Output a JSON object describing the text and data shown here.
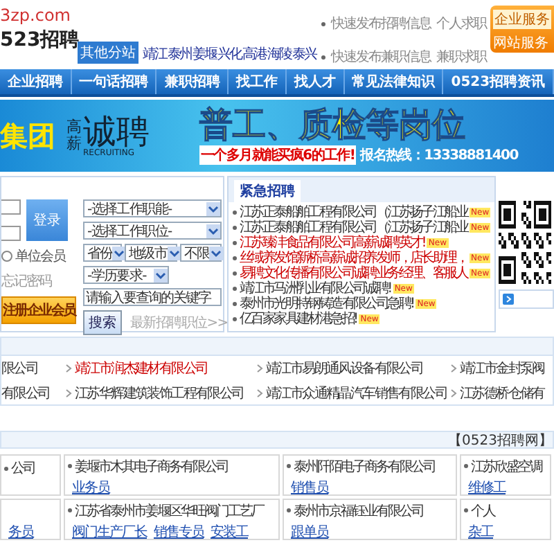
{
  "header": {
    "logo_domain": "3zp.com",
    "logo_name": "523招聘",
    "substation_button": "其他分站",
    "cities": [
      "靖江",
      "泰州",
      "姜堰",
      "兴化",
      "高港",
      "海陵",
      "泰兴"
    ],
    "quick_links": [
      {
        "text": "快速发布招聘信息",
        "extra": "个人求职"
      },
      {
        "text": "快速发布兼职信息",
        "extra": "兼职求职"
      }
    ],
    "service_box": {
      "tag": "企业服务",
      "line": "网站服务"
    }
  },
  "nav": {
    "items": [
      "企业招聘",
      "一句话招聘",
      "兼职招聘",
      "找工作",
      "找人才",
      "常见法律知识",
      "0523招聘资讯"
    ]
  },
  "banner": {
    "left_text": "集团",
    "small_text": "高薪",
    "big_text": "诚聘",
    "english": "RECRUITING",
    "headline": "普工、质检等岗位",
    "slogan": "一个多月就能买疯6的工作!",
    "hotline": "报名热线：13338881400"
  },
  "login": {
    "login_button": "登录",
    "radio_label": "单位会员",
    "radio_checked": false,
    "forgot": "忘记密码",
    "register": "注册企业会员"
  },
  "search": {
    "function": "-选择工作职能-",
    "position": "-选择工作职位-",
    "province": "省份",
    "city": "地级市",
    "limit": "不限",
    "education": "-学历要求-",
    "keyword_value": "请输入要查询的关键字",
    "search_button": "搜索",
    "latest_link": "最新招聘职位>>"
  },
  "urgent": {
    "title": "紧急招聘",
    "items": [
      {
        "text": "江苏正泰船舶工程有限公司（江苏扬子江船业",
        "color": "#333333",
        "badge": "New"
      },
      {
        "text": "江苏正泰船舶工程有限公司（江苏扬子江船业",
        "color": "#333333",
        "badge": "New"
      },
      {
        "text": "江苏臻沣食品有限公司高薪诚聘英才!",
        "color": "#cc0000",
        "badge": "New"
      },
      {
        "text": "丝域养发馆新桥高薪诚招养发师，店长助理，",
        "color": "#cc0000",
        "badge": "New"
      },
      {
        "text": "易聘文化传播有限公司诚聘业务经理、客服人",
        "color": "#cc0000",
        "badge": "New"
      },
      {
        "text": "靖江市马洲乳业有限公司诚聘!",
        "color": "#333333",
        "badge": "New"
      },
      {
        "text": "泰州市光明特钢铸造有限公司急聘!",
        "color": "#333333",
        "badge": "New"
      },
      {
        "text": "亿百家家具建材港急招!",
        "color": "#333333",
        "badge": "New"
      }
    ]
  },
  "companies": {
    "rows": [
      [
        {
          "text": "限公司",
          "color": "#333333"
        },
        {
          "text": "靖江市润杰建材有限公司",
          "color": "#cc0000"
        },
        {
          "text": "靖江市易朗通风设备有限公司",
          "color": "#333333"
        },
        {
          "text": "靖江市金封泵阀",
          "color": "#333333"
        }
      ],
      [
        {
          "text": "有限公司",
          "color": "#333333"
        },
        {
          "text": "江苏华辉建筑装饰工程有限公司",
          "color": "#333333"
        },
        {
          "text": "靖江市众通精晶汽车销售有限公司",
          "color": "#333333"
        },
        {
          "text": "江苏德桥仓储有",
          "color": "#333333"
        }
      ]
    ]
  },
  "jobs": {
    "source": "【0523招聘网】",
    "cards": [
      {
        "company": "公司"
      },
      {
        "company": "姜堰市木其电子商务有限公司",
        "jobs": [
          "业务员"
        ]
      },
      {
        "company": "泰州阡陌电子商务有限公司",
        "jobs": [
          "销售员"
        ]
      },
      {
        "company": "江苏欣盛空调",
        "jobs": [
          "维修工"
        ]
      },
      {
        "jobs": [
          "务员"
        ]
      },
      {
        "company": "江苏省泰州市姜堰区华旺阀门工艺厂",
        "jobs": [
          "阀门生产厂长",
          "销售专员",
          "安装工"
        ]
      },
      {
        "company": "泰州市京福钰业有限公司",
        "jobs": [
          "跟单员"
        ]
      },
      {
        "company": "个人",
        "jobs": [
          "杂工"
        ]
      }
    ]
  }
}
